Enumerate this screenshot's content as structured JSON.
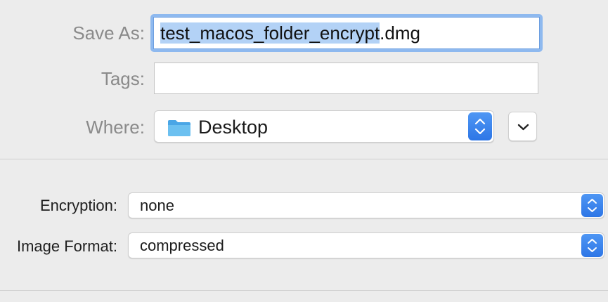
{
  "save_as": {
    "label": "Save As:",
    "filename_selected": "test_macos_folder_encrypt",
    "filename_extension": ".dmg"
  },
  "tags": {
    "label": "Tags:",
    "value": ""
  },
  "where": {
    "label": "Where:",
    "value": "Desktop",
    "icon": "folder-icon"
  },
  "encryption": {
    "label": "Encryption:",
    "value": "none"
  },
  "image_format": {
    "label": "Image Format:",
    "value": "compressed"
  },
  "colors": {
    "accent": "#2d76e6",
    "selection": "#b3d2f6",
    "focus_ring": "#8eb9ef",
    "folder": "#5fb4ea"
  }
}
